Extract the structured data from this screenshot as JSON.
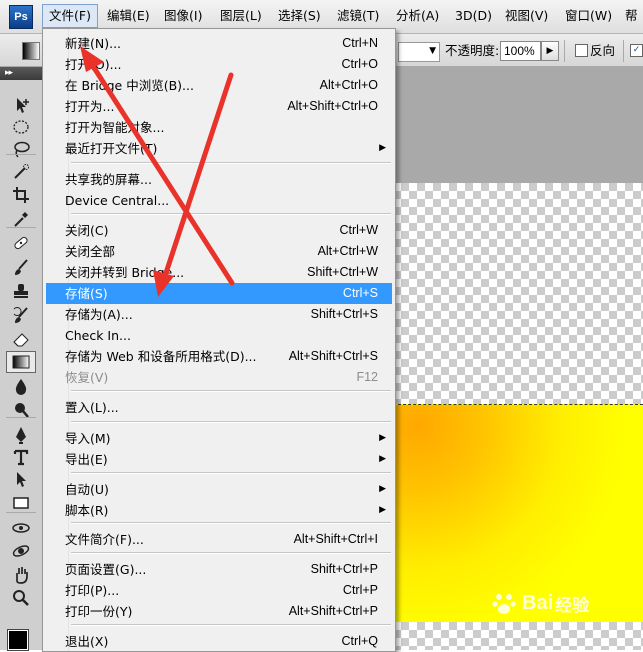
{
  "menubar": {
    "logo": "Ps",
    "items": [
      {
        "label": "文件(F)",
        "active": true
      },
      {
        "label": "编辑(E)"
      },
      {
        "label": "图像(I)"
      },
      {
        "label": "图层(L)"
      },
      {
        "label": "选择(S)"
      },
      {
        "label": "滤镜(T)"
      },
      {
        "label": "分析(A)"
      },
      {
        "label": "3D(D)"
      },
      {
        "label": "视图(V)"
      },
      {
        "label": "窗口(W)"
      },
      {
        "label": "帮"
      }
    ]
  },
  "options_bar": {
    "opacity_label": "不透明度:",
    "opacity_value": "100%",
    "reverse_label": "反向",
    "dither_checked": true,
    "reverse_checked": false
  },
  "file_menu": {
    "items": [
      {
        "label": "新建(N)...",
        "shortcut": "Ctrl+N"
      },
      {
        "label": "打开(O)...",
        "shortcut": "Ctrl+O"
      },
      {
        "label": "在 Bridge 中浏览(B)...",
        "shortcut": "Alt+Ctrl+O"
      },
      {
        "label": "打开为...",
        "shortcut": "Alt+Shift+Ctrl+O"
      },
      {
        "label": "打开为智能对象...",
        "shortcut": ""
      },
      {
        "label": "最近打开文件(T)",
        "shortcut": "",
        "submenu": true
      },
      {
        "label": "共享我的屏幕...",
        "shortcut": ""
      },
      {
        "label": "Device Central...",
        "shortcut": ""
      },
      {
        "label": "关闭(C)",
        "shortcut": "Ctrl+W"
      },
      {
        "label": "关闭全部",
        "shortcut": "Alt+Ctrl+W"
      },
      {
        "label": "关闭并转到 Bridge...",
        "shortcut": "Shift+Ctrl+W"
      },
      {
        "label": "存储(S)",
        "shortcut": "Ctrl+S",
        "highlighted": true
      },
      {
        "label": "存储为(A)...",
        "shortcut": "Shift+Ctrl+S"
      },
      {
        "label": "Check In...",
        "shortcut": ""
      },
      {
        "label": "存储为 Web 和设备所用格式(D)...",
        "shortcut": "Alt+Shift+Ctrl+S"
      },
      {
        "label": "恢复(V)",
        "shortcut": "F12",
        "disabled": true
      },
      {
        "label": "置入(L)...",
        "shortcut": ""
      },
      {
        "label": "导入(M)",
        "shortcut": "",
        "submenu": true
      },
      {
        "label": "导出(E)",
        "shortcut": "",
        "submenu": true
      },
      {
        "label": "自动(U)",
        "shortcut": "",
        "submenu": true
      },
      {
        "label": "脚本(R)",
        "shortcut": "",
        "submenu": true
      },
      {
        "label": "文件简介(F)...",
        "shortcut": "Alt+Shift+Ctrl+I"
      },
      {
        "label": "页面设置(G)...",
        "shortcut": "Shift+Ctrl+P"
      },
      {
        "label": "打印(P)...",
        "shortcut": "Ctrl+P"
      },
      {
        "label": "打印一份(Y)",
        "shortcut": "Alt+Shift+Ctrl+P"
      },
      {
        "label": "退出(X)",
        "shortcut": "Ctrl+Q"
      }
    ]
  },
  "toolbox": {
    "tools": [
      "move-icon",
      "marquee-icon",
      "lasso-icon",
      "quick-select-icon",
      "crop-icon",
      "eyedropper-icon",
      "healing-brush-icon",
      "brush-icon",
      "clone-stamp-icon",
      "history-brush-icon",
      "eraser-icon",
      "gradient-icon",
      "blur-icon",
      "dodge-icon",
      "pen-icon",
      "type-icon",
      "path-select-icon",
      "rectangle-icon",
      "3d-rotate-icon",
      "3d-orbit-icon",
      "hand-icon",
      "zoom-icon"
    ],
    "selected_tool": "gradient-icon"
  },
  "colors": {
    "highlight": "#3399ff",
    "arrow": "#e8322a",
    "gradient_start": "#ffa800",
    "gradient_end": "#ffff00"
  },
  "watermark": {
    "brand": "Bai",
    "suffix": "经验"
  }
}
